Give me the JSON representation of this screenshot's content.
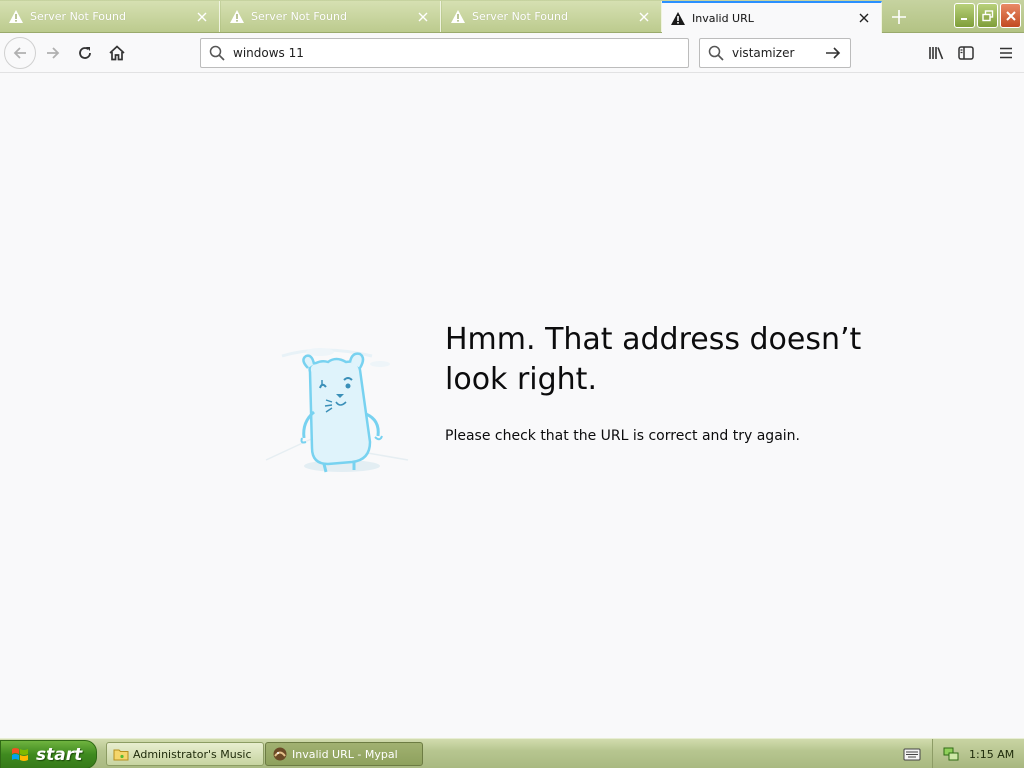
{
  "tabs": [
    {
      "label": "Server Not Found",
      "active": false
    },
    {
      "label": "Server Not Found",
      "active": false
    },
    {
      "label": "Server Not Found",
      "active": false
    },
    {
      "label": "Invalid URL",
      "active": true
    }
  ],
  "navbar": {
    "url_value": "windows 11",
    "search_value": "vistamizer"
  },
  "error_page": {
    "title": "Hmm. That address doesn’t look right.",
    "description": "Please check that the URL is correct and try again."
  },
  "taskbar": {
    "start_label": "start",
    "items": [
      {
        "label": "Administrator's Music"
      },
      {
        "label": "Invalid URL - Mypal"
      }
    ],
    "clock": "1:15 AM"
  },
  "colors": {
    "active_tab_accent": "#2a90ff",
    "tabbar_bg": "#bccb8e",
    "close_button": "#c24a22",
    "start_button": "#3f8a1f"
  }
}
